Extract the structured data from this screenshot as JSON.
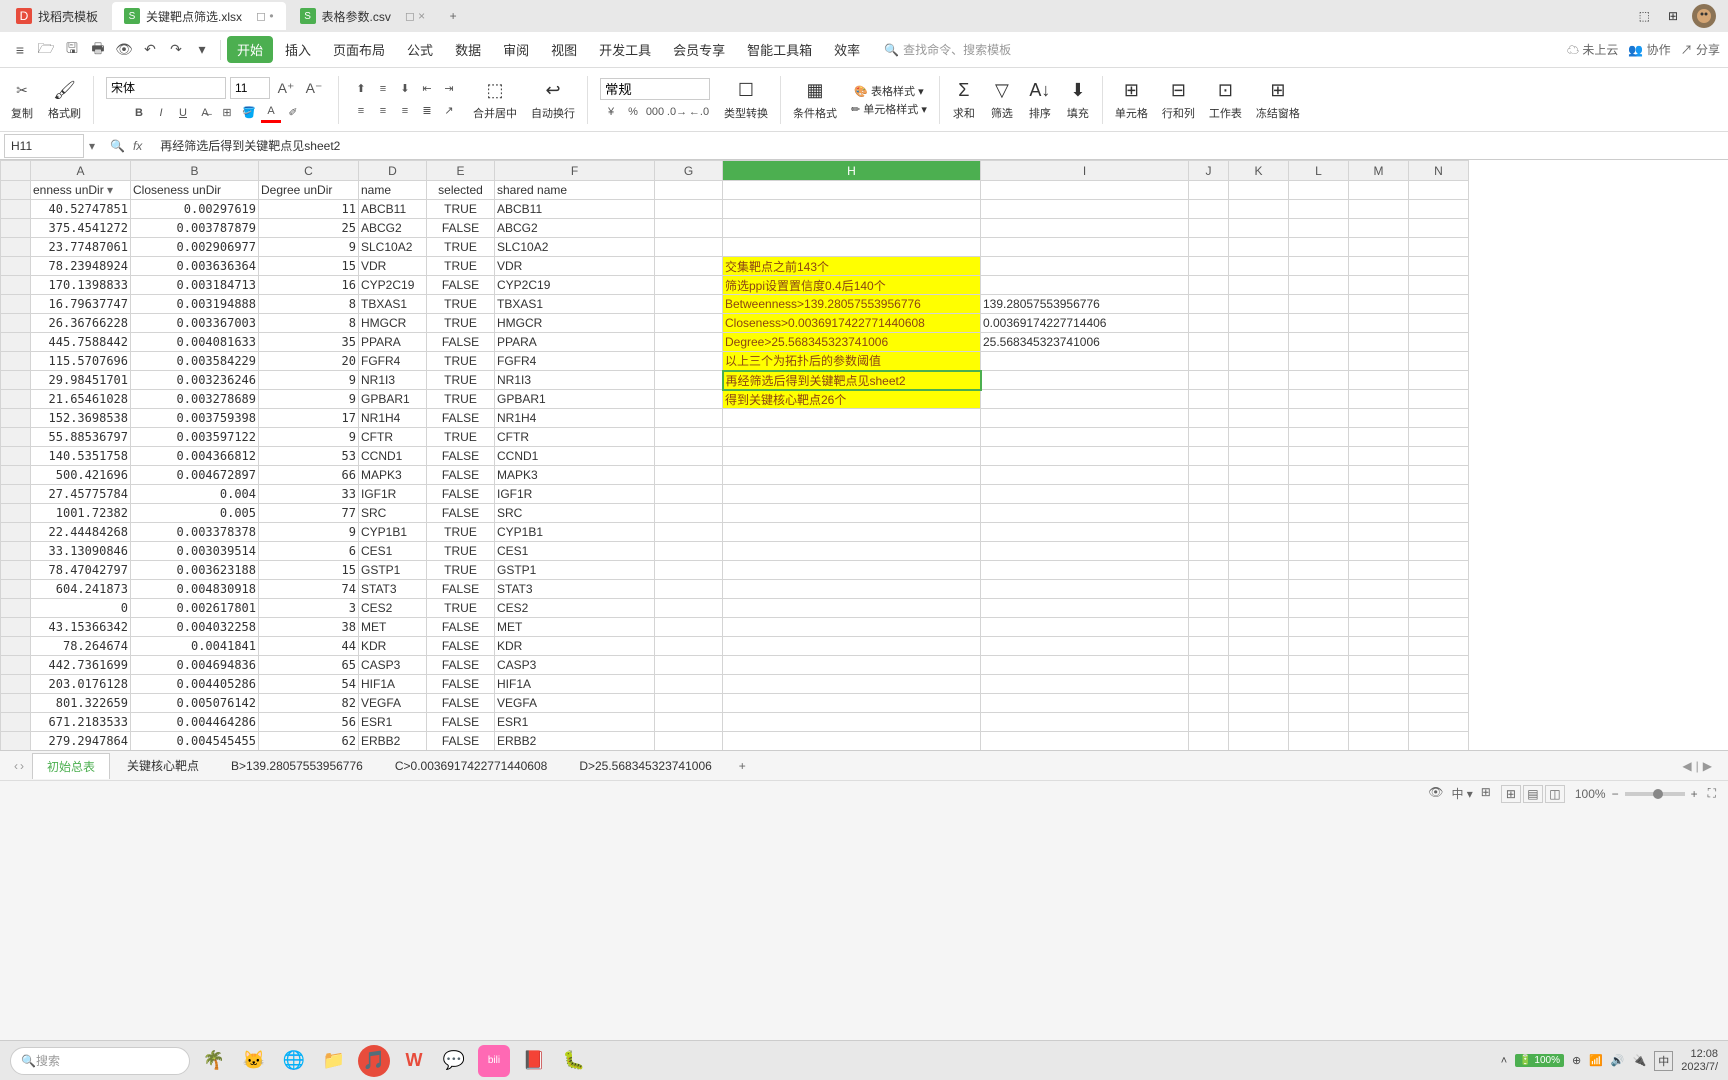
{
  "tabs": {
    "t1": "找稻壳模板",
    "t2": "关键靶点筛选.xlsx",
    "t3": "表格参数.csv"
  },
  "toolbar_right": {
    "cloud": "未上云",
    "coop": "协作",
    "share": "分享"
  },
  "menu": {
    "start": "开始",
    "insert": "插入",
    "layout": "页面布局",
    "formula": "公式",
    "data": "数据",
    "review": "审阅",
    "view": "视图",
    "dev": "开发工具",
    "member": "会员专享",
    "smart": "智能工具箱",
    "effect": "效率",
    "search_ph": "查找命令、搜索模板"
  },
  "ribbon": {
    "cut": "剪切",
    "copy": "复制",
    "brush": "格式刷",
    "font_name": "宋体",
    "font_size": "11",
    "merge": "合并居中",
    "wrap": "自动换行",
    "num_fmt": "常规",
    "type_conv": "类型转换",
    "cond_fmt": "条件格式",
    "table_style": "表格样式",
    "cell_style": "单元格样式",
    "sum": "求和",
    "filter": "筛选",
    "sort": "排序",
    "fill": "填充",
    "cell": "单元格",
    "rowcol": "行和列",
    "sheet": "工作表",
    "freeze": "冻结窗格"
  },
  "name_box": "H11",
  "formula": "再经筛选后得到关键靶点见sheet2",
  "columns": [
    "A",
    "B",
    "C",
    "D",
    "E",
    "F",
    "G",
    "H",
    "I",
    "J",
    "K",
    "L",
    "M",
    "N"
  ],
  "headers": {
    "a": "enness unDir",
    "b": "Closeness unDir",
    "c": "Degree unDir",
    "d": "name",
    "e": "selected",
    "f": "shared name"
  },
  "chart_data": {
    "type": "table",
    "rows": [
      {
        "a": "40.52747851",
        "b": "0.00297619",
        "c": "11",
        "d": "ABCB11",
        "e": "TRUE",
        "f": "ABCB11"
      },
      {
        "a": "375.4541272",
        "b": "0.003787879",
        "c": "25",
        "d": "ABCG2",
        "e": "FALSE",
        "f": "ABCG2"
      },
      {
        "a": "23.77487061",
        "b": "0.002906977",
        "c": "9",
        "d": "SLC10A2",
        "e": "TRUE",
        "f": "SLC10A2"
      },
      {
        "a": "78.23948924",
        "b": "0.003636364",
        "c": "15",
        "d": "VDR",
        "e": "TRUE",
        "f": "VDR"
      },
      {
        "a": "170.1398833",
        "b": "0.003184713",
        "c": "16",
        "d": "CYP2C19",
        "e": "FALSE",
        "f": "CYP2C19"
      },
      {
        "a": "16.79637747",
        "b": "0.003194888",
        "c": "8",
        "d": "TBXAS1",
        "e": "TRUE",
        "f": "TBXAS1"
      },
      {
        "a": "26.36766228",
        "b": "0.003367003",
        "c": "8",
        "d": "HMGCR",
        "e": "TRUE",
        "f": "HMGCR"
      },
      {
        "a": "445.7588442",
        "b": "0.004081633",
        "c": "35",
        "d": "PPARA",
        "e": "FALSE",
        "f": "PPARA"
      },
      {
        "a": "115.5707696",
        "b": "0.003584229",
        "c": "20",
        "d": "FGFR4",
        "e": "TRUE",
        "f": "FGFR4"
      },
      {
        "a": "29.98451701",
        "b": "0.003236246",
        "c": "9",
        "d": "NR1I3",
        "e": "TRUE",
        "f": "NR1I3"
      },
      {
        "a": "21.65461028",
        "b": "0.003278689",
        "c": "9",
        "d": "GPBAR1",
        "e": "TRUE",
        "f": "GPBAR1"
      },
      {
        "a": "152.3698538",
        "b": "0.003759398",
        "c": "17",
        "d": "NR1H4",
        "e": "FALSE",
        "f": "NR1H4"
      },
      {
        "a": "55.88536797",
        "b": "0.003597122",
        "c": "9",
        "d": "CFTR",
        "e": "TRUE",
        "f": "CFTR"
      },
      {
        "a": "140.5351758",
        "b": "0.004366812",
        "c": "53",
        "d": "CCND1",
        "e": "FALSE",
        "f": "CCND1"
      },
      {
        "a": "500.421696",
        "b": "0.004672897",
        "c": "66",
        "d": "MAPK3",
        "e": "FALSE",
        "f": "MAPK3"
      },
      {
        "a": "27.45775784",
        "b": "0.004",
        "c": "33",
        "d": "IGF1R",
        "e": "FALSE",
        "f": "IGF1R"
      },
      {
        "a": "1001.72382",
        "b": "0.005",
        "c": "77",
        "d": "SRC",
        "e": "FALSE",
        "f": "SRC"
      },
      {
        "a": "22.44484268",
        "b": "0.003378378",
        "c": "9",
        "d": "CYP1B1",
        "e": "TRUE",
        "f": "CYP1B1"
      },
      {
        "a": "33.13090846",
        "b": "0.003039514",
        "c": "6",
        "d": "CES1",
        "e": "TRUE",
        "f": "CES1"
      },
      {
        "a": "78.47042797",
        "b": "0.003623188",
        "c": "15",
        "d": "GSTP1",
        "e": "TRUE",
        "f": "GSTP1"
      },
      {
        "a": "604.241873",
        "b": "0.004830918",
        "c": "74",
        "d": "STAT3",
        "e": "FALSE",
        "f": "STAT3"
      },
      {
        "a": "0",
        "b": "0.002617801",
        "c": "3",
        "d": "CES2",
        "e": "TRUE",
        "f": "CES2"
      },
      {
        "a": "43.15366342",
        "b": "0.004032258",
        "c": "38",
        "d": "MET",
        "e": "FALSE",
        "f": "MET"
      },
      {
        "a": "78.264674",
        "b": "0.0041841",
        "c": "44",
        "d": "KDR",
        "e": "FALSE",
        "f": "KDR"
      },
      {
        "a": "442.7361699",
        "b": "0.004694836",
        "c": "65",
        "d": "CASP3",
        "e": "FALSE",
        "f": "CASP3"
      },
      {
        "a": "203.0176128",
        "b": "0.004405286",
        "c": "54",
        "d": "HIF1A",
        "e": "FALSE",
        "f": "HIF1A"
      },
      {
        "a": "801.322659",
        "b": "0.005076142",
        "c": "82",
        "d": "VEGFA",
        "e": "FALSE",
        "f": "VEGFA"
      },
      {
        "a": "671.2183533",
        "b": "0.004464286",
        "c": "56",
        "d": "ESR1",
        "e": "FALSE",
        "f": "ESR1"
      },
      {
        "a": "279.2947864",
        "b": "0.004545455",
        "c": "62",
        "d": "ERBB2",
        "e": "FALSE",
        "f": "ERBB2"
      }
    ]
  },
  "notes": {
    "l1": "交集靶点之前143个",
    "l2": "筛选ppi设置置信度0.4后140个",
    "l3": "Betweenness>139.28057553956776",
    "l4": "Closeness>0.00369174227714406​08",
    "l5": "Degree>25.568345323741006",
    "l6": "以上三个为拓扑后的参数阈值",
    "l7": "再经筛选后得到关键靶点见sheet2",
    "l8": "得到关键核心靶点26个"
  },
  "side_vals": {
    "v1": "139.28057553956776",
    "v2": "0.00369174227714406",
    "v3": "25.568345323741006"
  },
  "sheet_tabs": {
    "s1": "初始总表",
    "s2": "关键核心靶点",
    "s3": "B>139.28057553956776",
    "s4": "C>0.0036917422771440608",
    "s5": "D>25.568345323741006"
  },
  "status": {
    "zoom": "100%",
    "percent": "100%"
  },
  "taskbar": {
    "search": "搜索",
    "ime": "中",
    "time": "12:08",
    "date": "2023/7/"
  }
}
